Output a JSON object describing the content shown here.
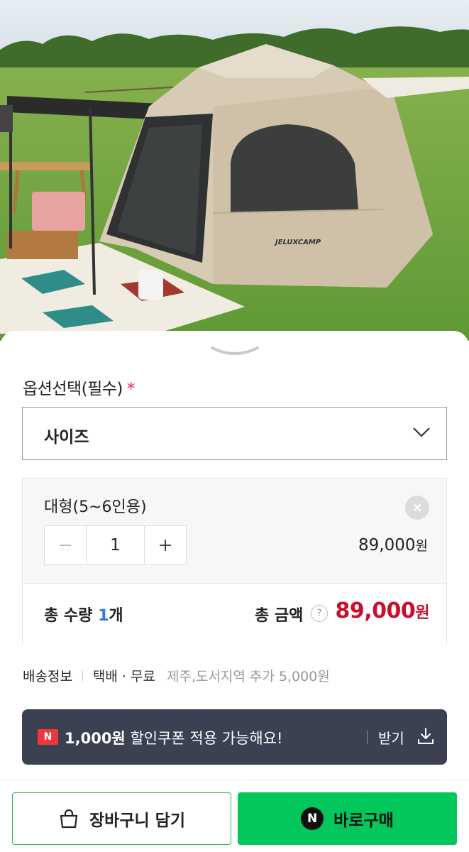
{
  "product_image": {
    "brand_text": "JELUXCAMP"
  },
  "option": {
    "title": "옵션선택(필수)",
    "required_mark": "*",
    "select_label": "사이즈"
  },
  "selected_item": {
    "name": "대형(5~6인용)",
    "quantity": "1",
    "price": "89,000",
    "price_unit": "원"
  },
  "total": {
    "qty_label": "총 수량",
    "qty_value": "1",
    "qty_unit": "개",
    "amount_label": "총 금액",
    "help_icon_text": "?",
    "amount": "89,000",
    "amount_unit": "원"
  },
  "shipping": {
    "label": "배송정보",
    "method": "택배 · 무료",
    "extra": "제주,도서지역 추가 5,000원"
  },
  "coupon": {
    "badge": "N",
    "amount": "1,000원",
    "message": "할인쿠폰 적용 가능해요!",
    "action_label": "받기"
  },
  "buttons": {
    "cart_label": "장바구니 담기",
    "buy_label": "바로구매",
    "buy_logo": "N"
  },
  "colors": {
    "accent_red": "#c8102e",
    "naver_green": "#03c75a",
    "coupon_bg": "#3c4152",
    "quantity_blue": "#2f7bd8"
  }
}
